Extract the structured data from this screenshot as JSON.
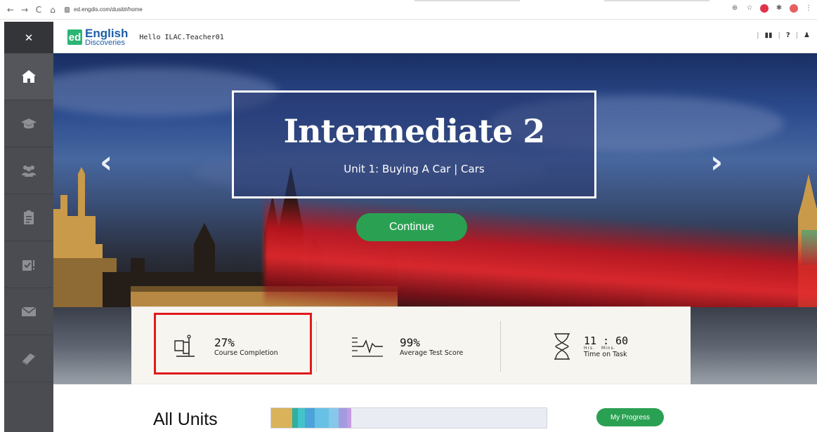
{
  "browser": {
    "url": "ed.engdis.com/dusit#/home"
  },
  "header": {
    "logo_short": "ed",
    "logo_line1": "English",
    "logo_line2": "Discoveries",
    "greeting": "Hello ILAC.Teacher01",
    "help_label": "?"
  },
  "sidebar": {
    "items": [
      "home-icon",
      "graduation-cap-icon",
      "group-icon",
      "clipboard-icon",
      "assignments-icon",
      "envelope-icon",
      "book-icon"
    ]
  },
  "hero": {
    "title": "Intermediate 2",
    "subtitle": "Unit 1: Buying A Car  |  Cars",
    "continue_label": "Continue"
  },
  "stats": {
    "completion_value": "27%",
    "completion_label": "Course Completion",
    "score_value": "99%",
    "score_label": "Average Test Score",
    "time_value": "11 : 60",
    "time_hrs": "Hrs.",
    "time_mins": "Mins.",
    "time_label": "Time on Task"
  },
  "units": {
    "title": "All Units",
    "my_progress_label": "My Progress",
    "segment_colors": [
      "#d9b25a",
      "#2fb0a0",
      "#43c4c9",
      "#4aa3d9",
      "#67c1e5",
      "#86c8ea",
      "#a39ae0",
      "#c49ae3"
    ]
  },
  "colors": {
    "accent_green": "#2aa152",
    "highlight_red": "#e0191d",
    "logo_blue": "#1d5ea8"
  }
}
